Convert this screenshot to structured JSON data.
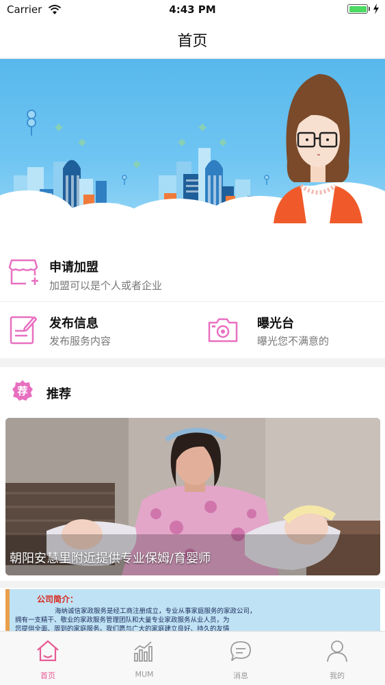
{
  "status_bar": {
    "carrier": "Carrier",
    "time": "4:43 PM"
  },
  "nav": {
    "title": "首页"
  },
  "menu": {
    "join": {
      "title": "申请加盟",
      "subtitle": "加盟可以是个人或者企业",
      "icon": "storefront-add-icon"
    },
    "publish": {
      "title": "发布信息",
      "subtitle": "发布服务内容",
      "icon": "edit-document-icon"
    },
    "exposure": {
      "title": "曝光台",
      "subtitle": "曝光您不满意的",
      "icon": "camera-icon"
    }
  },
  "recommend": {
    "badge": "荐",
    "title": "推荐",
    "card_caption": "朝阳安慧里附近提供专业保姆/育婴师"
  },
  "company": {
    "heading": "公司简介：",
    "lines": [
      "海纳诚信家政服务是经工商注册成立，专业从事家庭服务的家政公司，",
      "拥有一支精干、敬业的家政服务管理团队和大量专业家政服务从业人员，为",
      "您提供全面、周到的家庭服务。我们愿与广大的家庭建立良好、持久的友情"
    ]
  },
  "tabs": [
    {
      "label": "首页",
      "icon": "home-icon",
      "active": true
    },
    {
      "label": "MUM",
      "icon": "chart-icon",
      "active": false
    },
    {
      "label": "消息",
      "icon": "message-icon",
      "active": false
    },
    {
      "label": "我的",
      "icon": "person-icon",
      "active": false
    }
  ],
  "colors": {
    "accent": "#e85a94",
    "icon_pink": "#e86fc0",
    "banner_blue": "#58b8ec"
  }
}
